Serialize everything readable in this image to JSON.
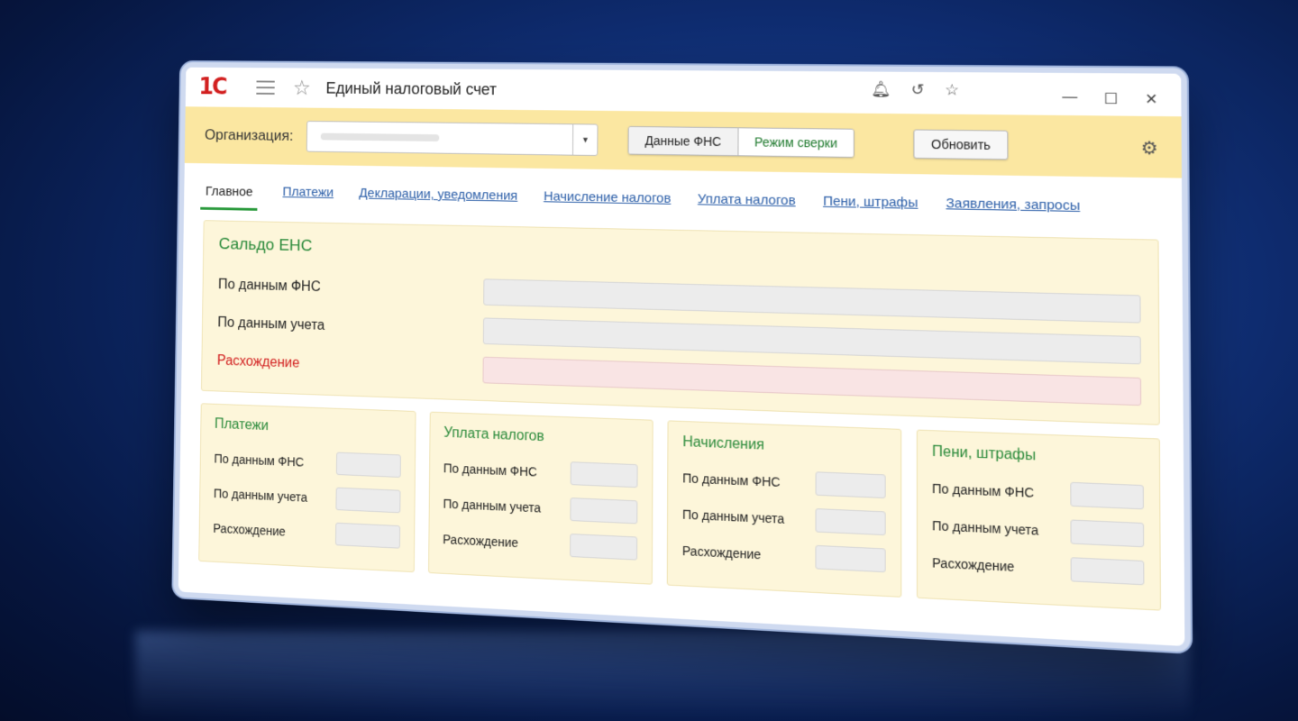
{
  "window": {
    "logo_text": "1С",
    "title": "Единый налоговый счет",
    "controls": [
      "—",
      "☐",
      "✕"
    ]
  },
  "toolbar": {
    "org_label": "Организация:",
    "btn_fns_data": "Данные ФНС",
    "btn_reconcile": "Режим сверки",
    "btn_refresh": "Обновить"
  },
  "tabs": [
    {
      "label": "Главное",
      "active": true
    },
    {
      "label": "Платежи"
    },
    {
      "label": "Декларации, уведомления"
    },
    {
      "label": "Начисление налогов"
    },
    {
      "label": "Уплата налогов"
    },
    {
      "label": "Пени, штрафы"
    },
    {
      "label": "Заявления, запросы"
    }
  ],
  "saldo": {
    "title": "Сальдо ЕНС",
    "rows": [
      {
        "label": "По данным ФНС"
      },
      {
        "label": "По данным учета"
      },
      {
        "label": "Расхождение"
      }
    ]
  },
  "cards": [
    {
      "title": "Платежи",
      "rows": [
        "По данным ФНС",
        "По данным учета",
        "Расхождение"
      ]
    },
    {
      "title": "Уплата налогов",
      "rows": [
        "По данным ФНС",
        "По данным учета",
        "Расхождение"
      ]
    },
    {
      "title": "Начисления",
      "rows": [
        "По данным ФНС",
        "По данным учета",
        "Расхождение"
      ]
    },
    {
      "title": "Пени, штрафы",
      "rows": [
        "По данным ФНС",
        "По данным учета",
        "Расхождение"
      ]
    }
  ],
  "colors": {
    "accent_green": "#2a8a3a",
    "link_blue": "#2b5ea8",
    "discrepancy_red": "#d21f1f",
    "toolbar_yellow": "#fbe7a1",
    "panel_cream": "#fdf6da"
  },
  "icons": [
    "menu-icon",
    "favorite-star-icon",
    "bell-icon",
    "history-icon",
    "star-icon",
    "minimize-icon",
    "maximize-icon",
    "close-icon",
    "gear-icon",
    "dropdown-arrow-icon"
  ]
}
